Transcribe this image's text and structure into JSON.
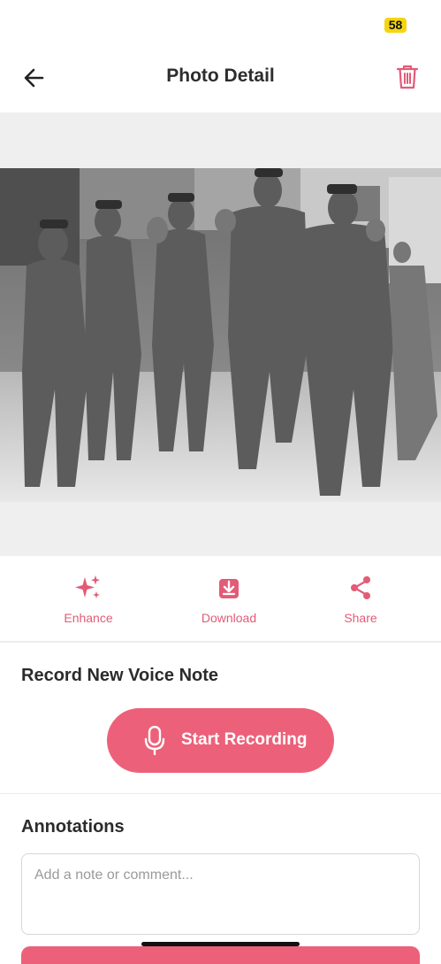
{
  "status_bar": {
    "battery": "58",
    "battery_color": "#f5d50f"
  },
  "header": {
    "title": "Photo Detail",
    "back_icon": "arrow-left-icon",
    "delete_icon": "trash-icon"
  },
  "photo": {
    "alt": "Black and white photograph of uniformed soldiers marching down a street"
  },
  "actions": [
    {
      "label": "Enhance",
      "icon": "sparkles-icon"
    },
    {
      "label": "Download",
      "icon": "download-icon"
    },
    {
      "label": "Share",
      "icon": "share-icon"
    }
  ],
  "voice_note": {
    "heading": "Record New Voice Note",
    "button_label": "Start Recording",
    "icon": "microphone-icon"
  },
  "annotations": {
    "heading": "Annotations",
    "placeholder": "Add a note or comment..."
  },
  "colors": {
    "accent": "#ec6179",
    "accent_text": "#e35b77",
    "photo_bg": "#efefef"
  }
}
